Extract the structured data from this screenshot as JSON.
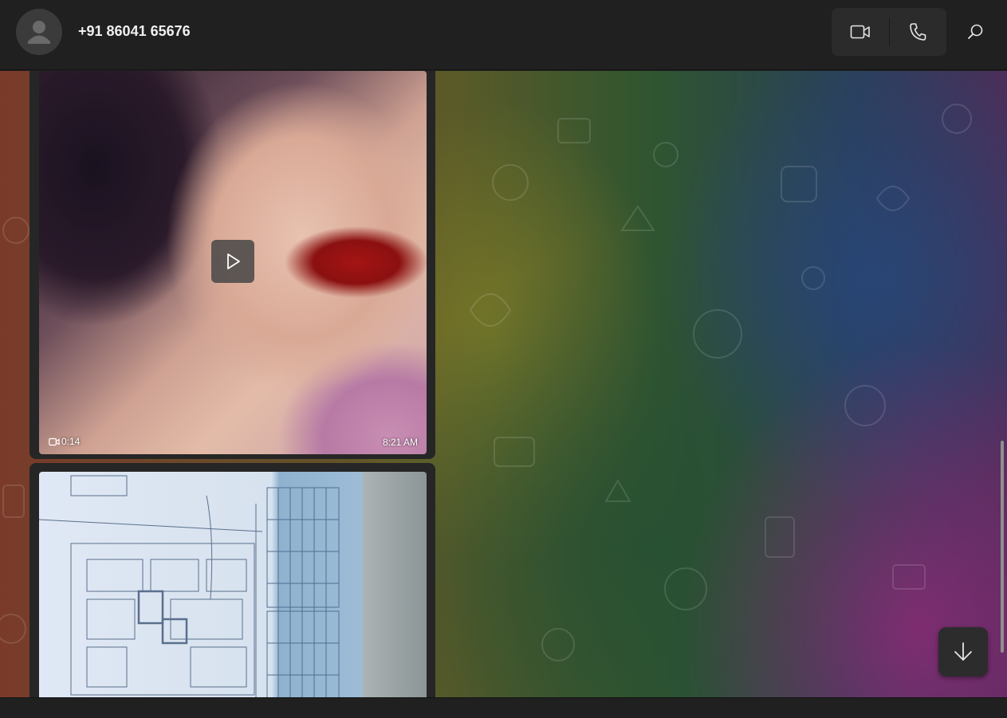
{
  "header": {
    "contact_name": "+91 86041 65676",
    "avatar_icon": "person-placeholder-icon",
    "video_call_icon": "video-camera-icon",
    "voice_call_icon": "phone-icon",
    "search_icon": "search-icon"
  },
  "messages": [
    {
      "type": "video",
      "duration": "0:14",
      "time": "8:21 AM",
      "play_icon": "play-icon",
      "duration_icon": "video-icon"
    },
    {
      "type": "image"
    }
  ],
  "scroll_down_icon": "arrow-down-icon",
  "colors": {
    "header_bg": "#202020",
    "bubble_bg": "#262626",
    "control_bg": "#2b2b2b"
  }
}
